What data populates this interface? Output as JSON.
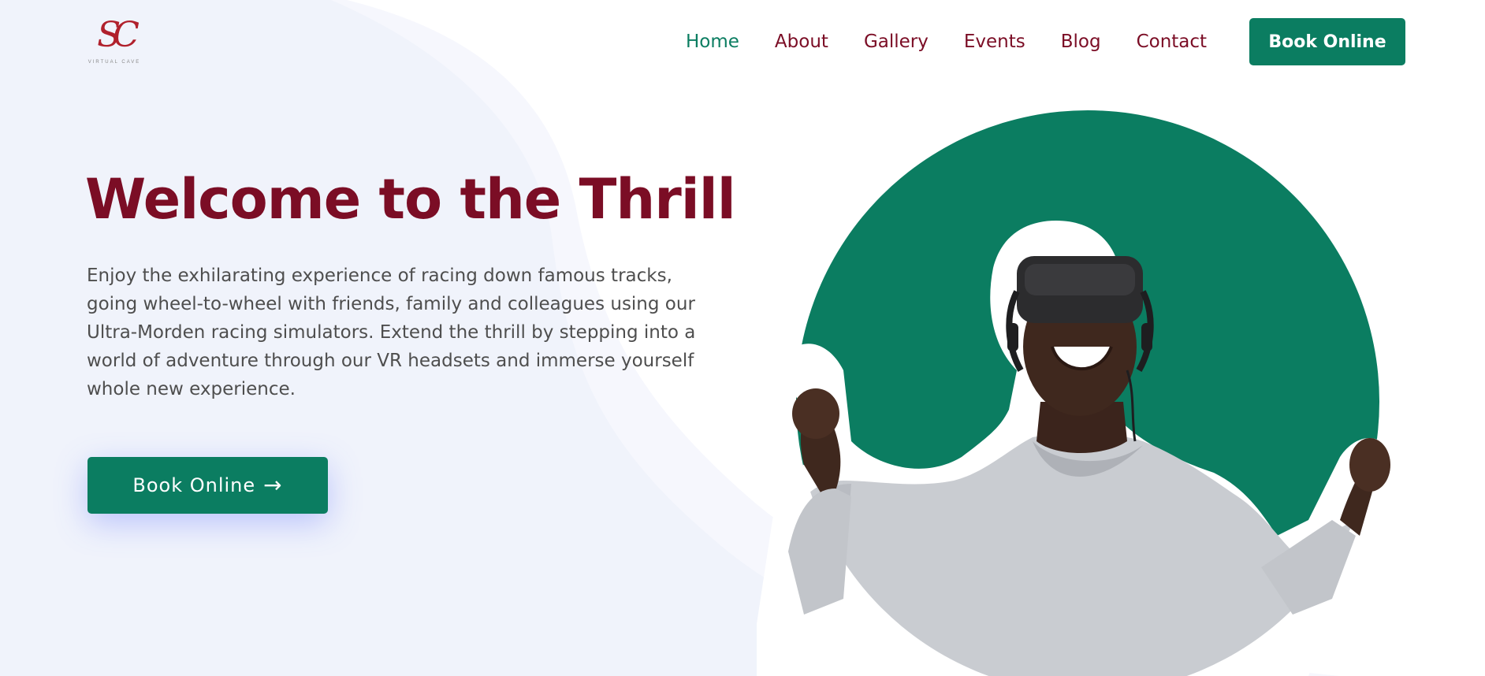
{
  "brand": {
    "logo_mark": "SC",
    "logo_subtext": "VIRTUAL CAVE",
    "colors": {
      "primary_green": "#0b7d61",
      "brand_maroon": "#7b0d25",
      "logo_red": "#b0202c",
      "background_tint": "#f0f3fb"
    }
  },
  "nav": {
    "items": [
      {
        "label": "Home",
        "active": true
      },
      {
        "label": "About",
        "active": false
      },
      {
        "label": "Gallery",
        "active": false
      },
      {
        "label": "Events",
        "active": false
      },
      {
        "label": "Blog",
        "active": false
      },
      {
        "label": "Contact",
        "active": false
      }
    ],
    "book_button_label": "Book Online"
  },
  "hero": {
    "title": "Welcome to the Thrill",
    "description": "Enjoy the exhilarating experience of racing down famous tracks, going wheel-to-wheel with friends, family and colleagues using our Ultra-Morden racing simulators. Extend the thrill by stepping into a world of adventure through our VR headsets and immerse yourself whole new experience.",
    "cta_label": "Book Online",
    "cta_icon": "arrow-right-icon",
    "image_icon": "vr-person-illustration"
  }
}
